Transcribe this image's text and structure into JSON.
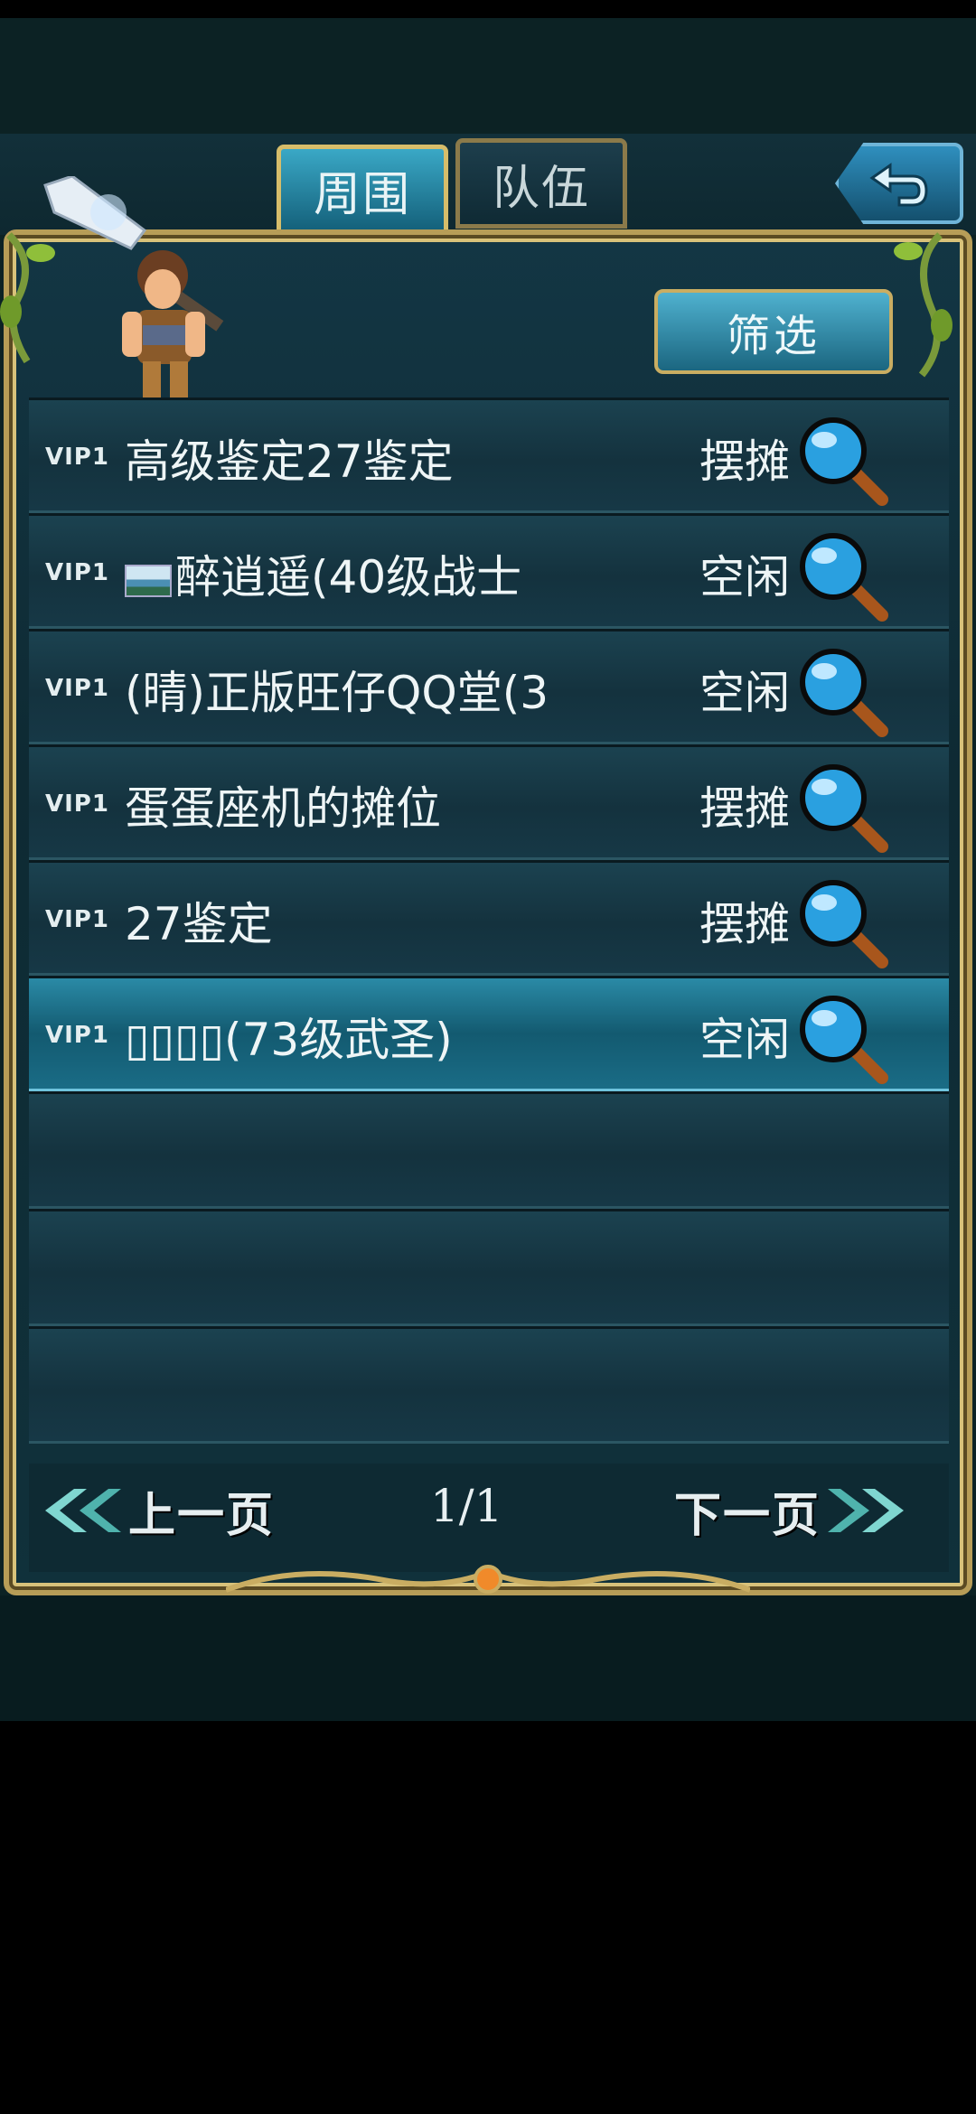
{
  "tabs": [
    {
      "label": "周围",
      "active": true
    },
    {
      "label": "队伍",
      "active": false
    }
  ],
  "filter_label": "筛选",
  "players": [
    {
      "vip": "VIP1",
      "name": "高级鉴定27鉴定",
      "status": "摆摊",
      "has_flag": false
    },
    {
      "vip": "VIP1",
      "name": "醉逍遥(40级战士",
      "status": "空闲",
      "has_flag": true
    },
    {
      "vip": "VIP1",
      "name": "(晴)正版旺仔QQ堂(3",
      "status": "空闲",
      "has_flag": false
    },
    {
      "vip": "VIP1",
      "name": "蛋蛋座机的摊位",
      "status": "摆摊",
      "has_flag": false
    },
    {
      "vip": "VIP1",
      "name": "27鉴定",
      "status": "摆摊",
      "has_flag": false
    },
    {
      "vip": "VIP1",
      "name": "▯▯▯▯(73级武圣)",
      "status": "空闲",
      "has_flag": false,
      "selected": true
    }
  ],
  "pagination": {
    "prev_label": "上一页",
    "next_label": "下一页",
    "page": "1/1"
  },
  "icons": {
    "back": "back-arrow-icon",
    "search": "magnifier-icon",
    "prev": "double-chevron-left-icon",
    "next": "double-chevron-right-icon"
  },
  "colors": {
    "gold_border": "#b79d57",
    "tab_active": "#3aa8c6",
    "row_selected": "#2a8aa6"
  }
}
